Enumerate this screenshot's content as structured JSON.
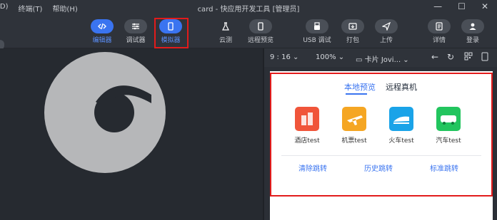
{
  "menu": [
    "(D)",
    "终端(T)",
    "帮助(H)"
  ],
  "window_title": "card - 快应用开发工具 [管理员]",
  "window_controls": [
    "—",
    "☐",
    "✕"
  ],
  "toolbar": {
    "editor": "编辑器",
    "debugger": "调试器",
    "simulator": "模拟器",
    "cloud_test": "云测",
    "remote_preview": "远程预览",
    "usb_debug": "USB 调试",
    "package": "打包",
    "upload": "上传",
    "details": "详情",
    "login": "登录"
  },
  "simbar": {
    "ratio": "9 : 16",
    "zoom": "100%",
    "mode": "卡片 Jovi..."
  },
  "simulator": {
    "tab_local": "本地预览",
    "tab_remote": "远程真机",
    "services": [
      {
        "label": "酒店test",
        "icon": "hotel-icon",
        "color": "#f0553a"
      },
      {
        "label": "机票test",
        "icon": "plane-icon",
        "color": "#f5a623"
      },
      {
        "label": "火车test",
        "icon": "train-icon",
        "color": "#1aa3e8"
      },
      {
        "label": "汽车test",
        "icon": "bus-icon",
        "color": "#22c55e"
      }
    ],
    "links": [
      "清除跳转",
      "历史跳转",
      "标准跳转"
    ]
  }
}
